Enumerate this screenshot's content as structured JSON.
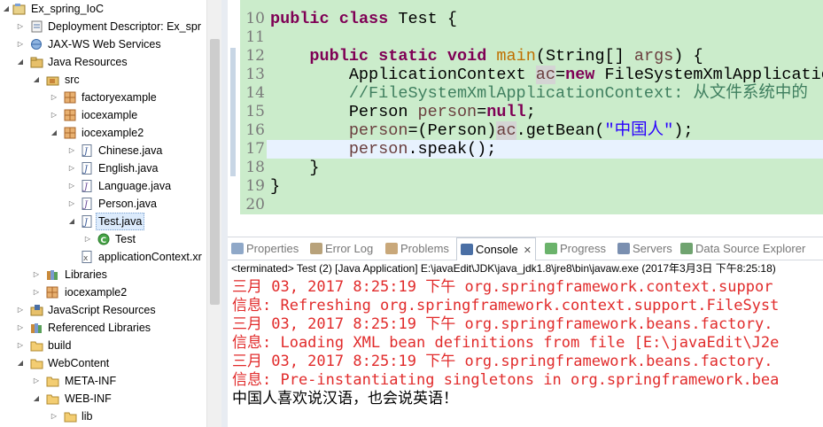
{
  "explorer": {
    "items": [
      {
        "label": "Ex_spring_IoC",
        "icon": "project-icon",
        "expanded": true
      },
      {
        "label": "Deployment Descriptor: Ex_spr",
        "icon": "deployment-descriptor-icon",
        "expanded": false
      },
      {
        "label": "JAX-WS Web Services",
        "icon": "web-services-icon",
        "expanded": false
      },
      {
        "label": "Java Resources",
        "icon": "java-resources-icon",
        "expanded": true
      },
      {
        "label": "src",
        "icon": "source-folder-icon",
        "expanded": true
      },
      {
        "label": "factoryexample",
        "icon": "package-icon",
        "expanded": false
      },
      {
        "label": "iocexample",
        "icon": "package-icon",
        "expanded": false
      },
      {
        "label": "iocexample2",
        "icon": "package-icon",
        "expanded": true
      },
      {
        "label": "Chinese.java",
        "icon": "java-file-icon",
        "expanded": false
      },
      {
        "label": "English.java",
        "icon": "java-file-icon",
        "expanded": false
      },
      {
        "label": "Language.java",
        "icon": "java-interface-file-icon",
        "expanded": false
      },
      {
        "label": "Person.java",
        "icon": "java-interface-file-icon",
        "expanded": false
      },
      {
        "label": "Test.java",
        "icon": "java-file-icon",
        "expanded": true
      },
      {
        "label": "Test",
        "icon": "class-main-icon",
        "expanded": false
      },
      {
        "label": "applicationContext.xr",
        "icon": "xml-file-icon",
        "expanded": false
      },
      {
        "label": "Libraries",
        "icon": "libraries-icon",
        "expanded": false
      },
      {
        "label": "iocexample2",
        "icon": "package-icon",
        "expanded": false
      },
      {
        "label": "JavaScript Resources",
        "icon": "javascript-resources-icon",
        "expanded": false
      },
      {
        "label": "Referenced Libraries",
        "icon": "referenced-libraries-icon",
        "expanded": false
      },
      {
        "label": "build",
        "icon": "folder-icon",
        "expanded": false
      },
      {
        "label": "WebContent",
        "icon": "folder-icon",
        "expanded": true
      },
      {
        "label": "META-INF",
        "icon": "folder-icon",
        "expanded": false
      },
      {
        "label": "WEB-INF",
        "icon": "folder-icon",
        "expanded": true
      },
      {
        "label": "lib",
        "icon": "folder-icon",
        "expanded": false
      }
    ]
  },
  "editor": {
    "line_numbers": [
      "10",
      "11",
      "12",
      "13",
      "14",
      "15",
      "16",
      "17",
      "18",
      "19",
      "20"
    ],
    "code": {
      "l10": {
        "kw1": "public",
        "kw2": "class",
        "rest": " Test {"
      },
      "l12": {
        "kw1": "public",
        "kw2": "static",
        "kw3": "void",
        "method": "main",
        "rest1": "(String[] ",
        "param": "args",
        "rest2": ") {"
      },
      "l13": {
        "type": "ApplicationContext ",
        "var": "ac",
        "eq": "=",
        "kw": "new",
        "rest": " FileSystemXmlApplicatio"
      },
      "l14": {
        "comment": "//FileSystemXmlApplicationContext: 从文件系统中的"
      },
      "l15": {
        "type": "Person ",
        "var": "person",
        "eq": "=",
        "kw": "null",
        "semi": ";"
      },
      "l16": {
        "var": "person",
        "mid": "=(Person)",
        "var2": "ac",
        "rest1": ".getBean(",
        "str": "\"中国人\"",
        "rest2": ");"
      },
      "l17": {
        "var": "person",
        "rest": ".speak();"
      },
      "l18": {
        "text": "}"
      },
      "l19": {
        "text": "}"
      }
    }
  },
  "console_view": {
    "tabs": [
      {
        "label": "Properties",
        "icon": "properties-icon",
        "color": "#8fa8c8"
      },
      {
        "label": "Error Log",
        "icon": "error-log-icon",
        "color": "#b8a27a"
      },
      {
        "label": "Problems",
        "icon": "problems-icon",
        "color": "#c9a87a"
      },
      {
        "label": "Console",
        "icon": "console-icon",
        "color": "#4a6fa5",
        "close": "✕"
      },
      {
        "label": "Progress",
        "icon": "progress-icon",
        "color": "#6bb36b"
      },
      {
        "label": "Servers",
        "icon": "servers-icon",
        "color": "#7a8fb0"
      },
      {
        "label": "Data Source Explorer",
        "icon": "data-source-explorer-icon",
        "color": "#6fa36f"
      }
    ],
    "status": "<terminated> Test (2) [Java Application] E:\\javaEdit\\JDK\\java_jdk1.8\\jre8\\bin\\javaw.exe (2017年3月3日 下午8:25:18)",
    "lines": [
      {
        "text": "三月 03, 2017 8:25:19 下午 org.springframework.context.suppor",
        "kind": "err"
      },
      {
        "text": "信息: Refreshing org.springframework.context.support.FileSyst",
        "kind": "err"
      },
      {
        "text": "三月 03, 2017 8:25:19 下午 org.springframework.beans.factory.",
        "kind": "err"
      },
      {
        "text": "信息: Loading XML bean definitions from file [E:\\javaEdit\\J2e",
        "kind": "err"
      },
      {
        "text": "三月 03, 2017 8:25:19 下午 org.springframework.beans.factory.",
        "kind": "err"
      },
      {
        "text": "信息: Pre-instantiating singletons in org.springframework.bea",
        "kind": "err"
      },
      {
        "text": "中国人喜欢说汉语，也会说英语！",
        "kind": "out"
      }
    ]
  },
  "colors": {
    "editor_background": "#cbeccb",
    "keyword": "#7f0055",
    "console_error": "#e12b2b",
    "current_line": "#e8f2fe"
  }
}
